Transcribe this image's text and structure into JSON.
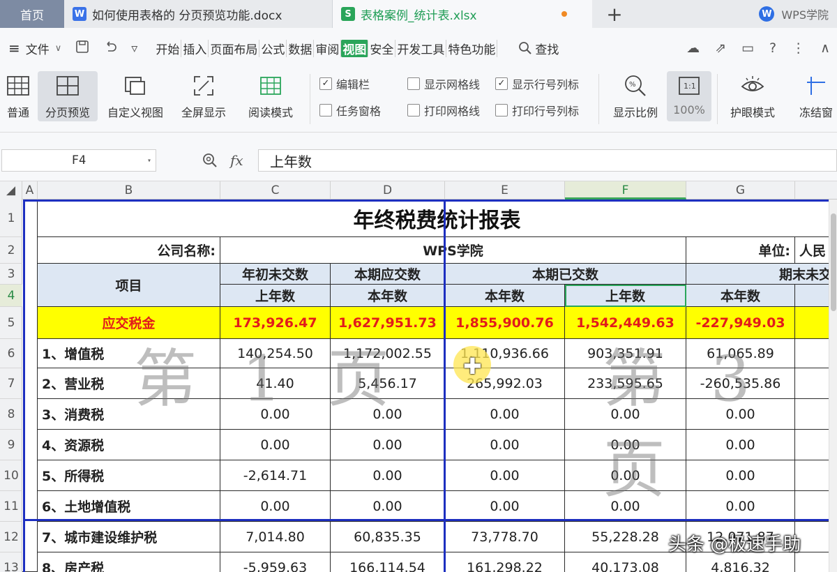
{
  "tabs": {
    "home": "首页",
    "doc": "如何使用表格的 分页预览功能.docx",
    "doc_icon": "W",
    "xls": "表格案例_统计表.xlsx",
    "xls_icon": "S",
    "add": "+",
    "academy": "WPS学院",
    "academy_logo": "W"
  },
  "menu": {
    "hamburger": "≡",
    "file": "文件",
    "caret": "∨",
    "items": [
      "开始",
      "插入",
      "页面布局",
      "公式",
      "数据",
      "审阅",
      "视图",
      "安全",
      "开发工具",
      "特色功能"
    ],
    "active": "视图",
    "search": "查找",
    "right_icons": [
      "cloud-icon",
      "share-icon",
      "box-icon",
      "help-icon",
      "more-icon",
      "collapse-icon"
    ]
  },
  "ribbon": {
    "normal": "普通",
    "page_break_preview": "分页预览",
    "custom_view": "自定义视图",
    "full_screen": "全屏显示",
    "reading_mode": "阅读模式",
    "formula_bar": "编辑栏",
    "task_pane": "任务窗格",
    "show_gridlines": "显示网格线",
    "print_gridlines": "打印网格线",
    "show_headers": "显示行号列标",
    "print_headers": "打印行号列标",
    "zoom": "显示比例",
    "zoom_value": "100%",
    "eye_mode": "护眼模式",
    "freeze": "冻结窗",
    "checks": {
      "formula_bar": true,
      "task_pane": false,
      "show_gridlines": false,
      "print_gridlines": false,
      "show_headers": true,
      "print_headers": false
    }
  },
  "formula": {
    "cell_ref": "F4",
    "fx": "fx",
    "value": "上年数"
  },
  "columns": [
    "A",
    "B",
    "C",
    "D",
    "E",
    "F",
    "G"
  ],
  "selected_column": "F",
  "rows": [
    "1",
    "2",
    "3",
    "4",
    "5",
    "6",
    "7",
    "8",
    "9",
    "10",
    "11",
    "12",
    "13"
  ],
  "selected_row": "4",
  "sheet": {
    "title": "年终税费统计报表",
    "company_label": "公司名称:",
    "company_value": "WPS学院",
    "unit_label": "单位:",
    "unit_value": "人民",
    "item_header": "项目",
    "group_begin": "年初未交数",
    "group_due": "本期应交数",
    "group_paid": "本期已交数",
    "group_end": "期末未交",
    "sub": [
      "上年数",
      "本年数",
      "本年数",
      "上年数",
      "本年数"
    ],
    "total_label": "应交税金",
    "total": [
      "173,926.47",
      "1,627,951.73",
      "1,855,900.76",
      "1,542,449.63",
      "-227,949.03"
    ],
    "items": [
      {
        "name": "1、增值税",
        "c": "140,254.50",
        "d": "1,172,002.55",
        "e": "1,110,936.66",
        "f": "903,351.91",
        "g": "61,065.89"
      },
      {
        "name": "2、营业税",
        "c": "41.40",
        "d": "5,456.17",
        "e": "265,992.03",
        "f": "233,595.65",
        "g": "-260,535.86"
      },
      {
        "name": "3、消费税",
        "c": "0.00",
        "d": "0.00",
        "e": "0.00",
        "f": "0.00",
        "g": "0.00"
      },
      {
        "name": "4、资源税",
        "c": "0.00",
        "d": "0.00",
        "e": "0.00",
        "f": "0.00",
        "g": "0.00"
      },
      {
        "name": "5、所得税",
        "c": "-2,614.71",
        "d": "0.00",
        "e": "0.00",
        "f": "0.00",
        "g": "0.00"
      },
      {
        "name": "6、土地增值税",
        "c": "0.00",
        "d": "0.00",
        "e": "0.00",
        "f": "0.00",
        "g": "0.00"
      },
      {
        "name": "7、城市建设维护税",
        "c": "7,014.80",
        "d": "60,835.35",
        "e": "73,778.70",
        "f": "55,228.28",
        "g": "12,071.87"
      },
      {
        "name": "8、房产税",
        "c": "-5,959.63",
        "d": "166,114.54",
        "e": "161,298.22",
        "f": "40,173.08",
        "g": "4,816.32"
      }
    ]
  },
  "watermarks": {
    "page1": "第 1 页",
    "page3": "第 3 页"
  },
  "credit": "头条 @极速手助"
}
